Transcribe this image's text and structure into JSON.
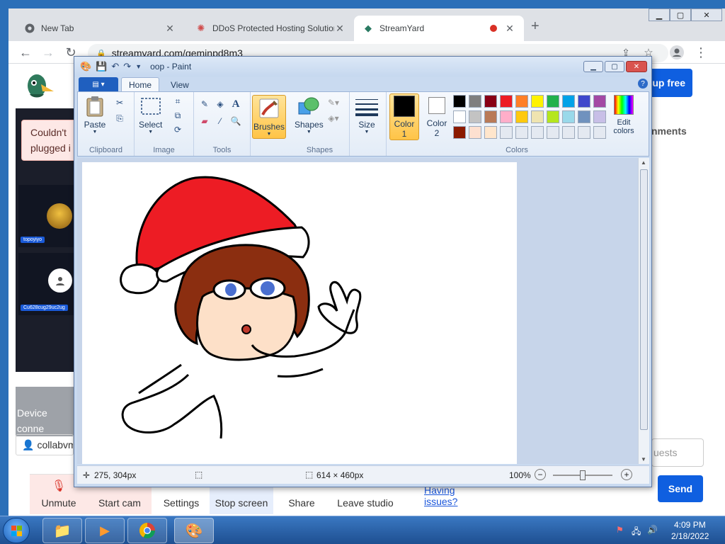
{
  "browser": {
    "tabs": [
      {
        "title": "New Tab",
        "icon": "chrome-icon"
      },
      {
        "title": "DDoS Protected Hosting Solution",
        "icon": "ddos-favicon"
      },
      {
        "title": "StreamYard",
        "icon": "streamyard-favicon"
      }
    ],
    "url": "streamyard.com/geminpd8m3"
  },
  "streamyard": {
    "signup_label": "up free",
    "alert_text_line1": "Couldn't",
    "alert_text_line2": "plugged i",
    "tile1_name": "topoyiyo",
    "tile2_name": "Cu628cug29uc2ug",
    "device_line1": "Device",
    "device_line2": "conne",
    "collab_label": "collabvm",
    "comments_label": "nments",
    "guests_placeholder": "uests",
    "send_label": "Send",
    "bottom_bar": {
      "unmute": "Unmute",
      "start_cam": "Start cam",
      "settings": "Settings",
      "stop_screen": "Stop screen",
      "share": "Share",
      "leave": "Leave studio",
      "issues": "Having issues?"
    }
  },
  "paint": {
    "title": "oop - Paint",
    "tabs": {
      "home": "Home",
      "view": "View"
    },
    "groups": {
      "clipboard": "Clipboard",
      "image": "Image",
      "tools": "Tools",
      "shapes": "Shapes",
      "colors": "Colors"
    },
    "buttons": {
      "paste": "Paste",
      "select": "Select",
      "brushes": "Brushes",
      "shapes": "Shapes",
      "size": "Size",
      "color1": "Color",
      "color1_num": "1",
      "color2": "Color",
      "color2_num": "2",
      "edit_colors_1": "Edit",
      "edit_colors_2": "colors"
    },
    "palette_row1": [
      "#000000",
      "#7f7f7f",
      "#880015",
      "#ed1c24",
      "#ff7f27",
      "#fff200",
      "#22b14c",
      "#00a2e8",
      "#3f48cc",
      "#a349a4"
    ],
    "palette_row2": [
      "#ffffff",
      "#c3c3c3",
      "#b97a57",
      "#ffaec9",
      "#ffc90e",
      "#efe4b0",
      "#b5e61d",
      "#99d9ea",
      "#7092be",
      "#c8bfe7"
    ],
    "palette_row3": [
      "#8b1a00",
      "#fde0d0",
      "#ffe6cc",
      "#e4e9f1",
      "#e4e9f1",
      "#e4e9f1",
      "#e4e9f1",
      "#e4e9f1",
      "#e4e9f1",
      "#e4e9f1"
    ],
    "color1_value": "#000000",
    "color2_value": "#ffffff",
    "status": {
      "cursor_pos": "275, 304px",
      "image_size": "614 × 460px",
      "zoom": "100%"
    },
    "drawing_colors": {
      "hat": "#ed1c24",
      "hair": "#8b2e10",
      "skin": "#fde0c8",
      "eyes": "#4a6fd0"
    }
  },
  "taskbar": {
    "time": "4:09 PM",
    "date": "2/18/2022"
  }
}
